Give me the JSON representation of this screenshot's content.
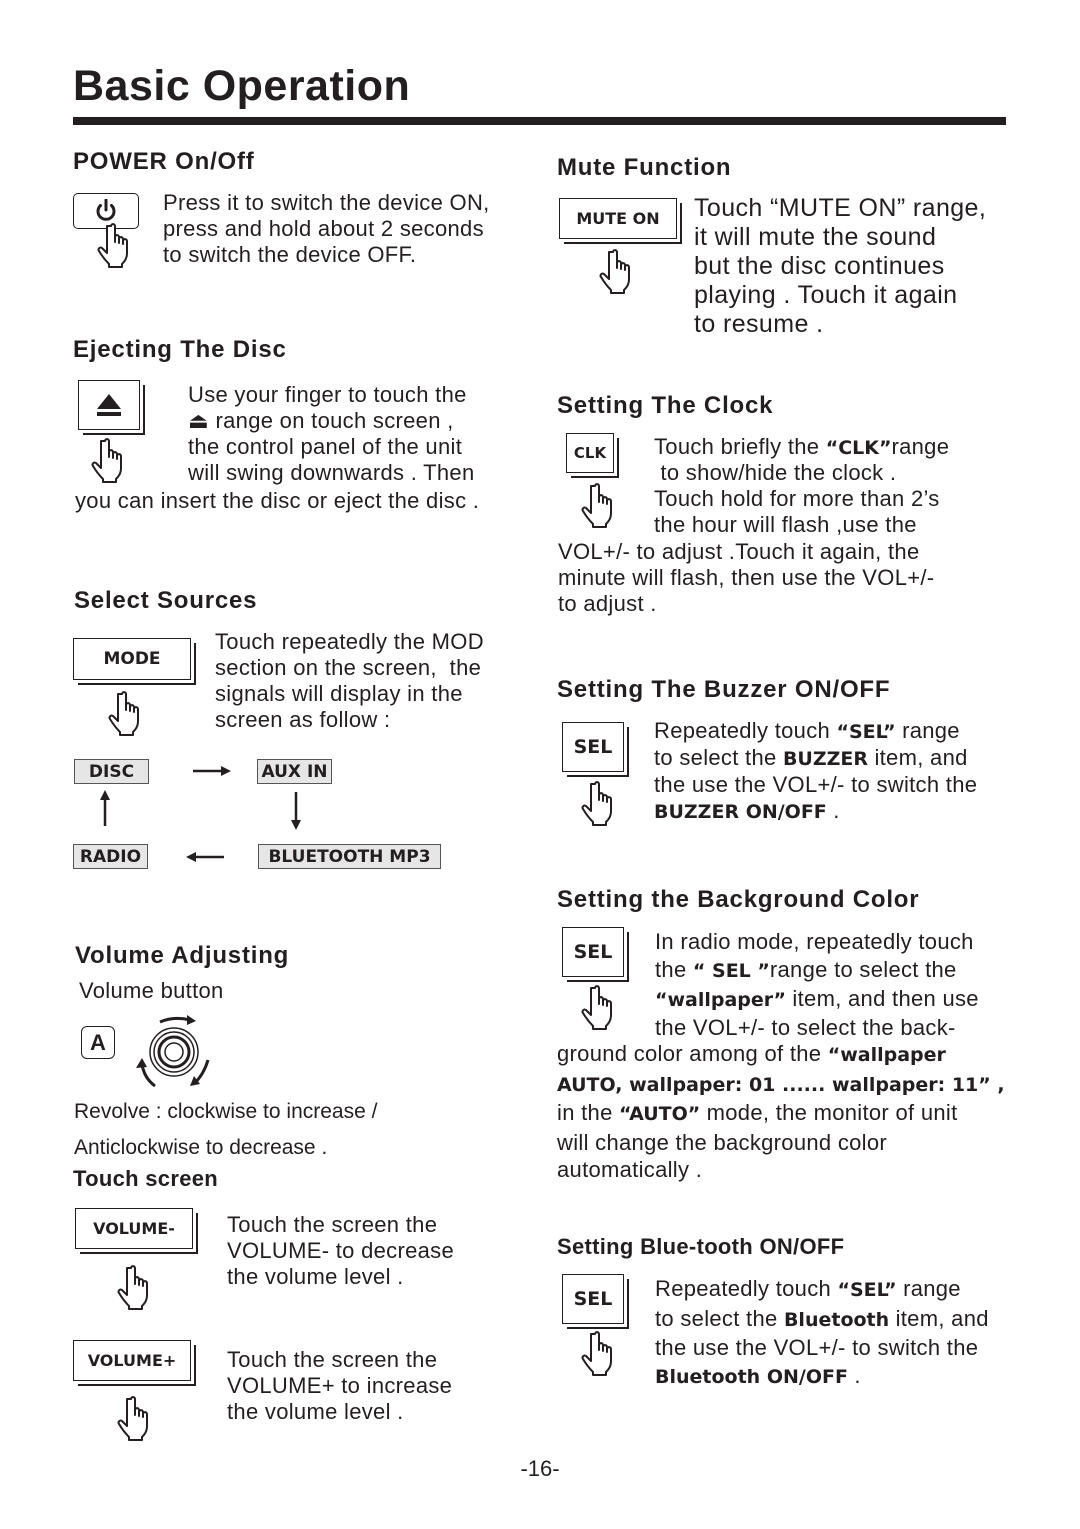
{
  "page": {
    "title": "Basic Operation",
    "page_number": "-16-"
  },
  "power": {
    "heading": "POWER On/Off",
    "button_icon": "power-icon",
    "text": "Press it to switch the device ON,\npress and hold about 2 seconds\nto switch the device OFF."
  },
  "eject": {
    "heading": "Ejecting The Disc",
    "button_icon": "eject-icon",
    "text_indented": "Use your finger to touch the\n⏏ range on touch screen ,\nthe control panel of the unit\nwill swing downwards . Then",
    "text_full": "you can insert the disc or eject the disc ."
  },
  "sources": {
    "heading": "Select Sources",
    "button_label": "MODE",
    "text": "Touch repeatedly the MOD\nsection on the screen,  the\nsignals will display in the\nscreen as follow :",
    "cycle": [
      "DISC",
      "AUX IN",
      "BLUETOOTH MP3",
      "RADIO"
    ]
  },
  "volume": {
    "heading": "Volume Adjusting",
    "subheading": "Volume button",
    "knob_label": "A",
    "revolve_line1": "Revolve : clockwise to increase /",
    "revolve_line2": "Anticlockwise to decrease .",
    "touch_heading": "Touch screen",
    "minus_button": "VOLUME-",
    "minus_text": "Touch the screen the\nVOLUME- to decrease\nthe volume level .",
    "plus_button": "VOLUME+",
    "plus_text": "Touch the screen the\nVOLUME+ to increase\nthe volume level ."
  },
  "mute": {
    "heading": "Mute Function",
    "button_label": "MUTE ON",
    "text": "Touch “MUTE ON” range,\nit will mute the sound\nbut the disc continues\nplaying . Touch it again\nto resume ."
  },
  "clock": {
    "heading": "Setting The Clock",
    "button_label": "CLK",
    "line1_pre": "Touch briefly the ",
    "line1_bold": "“CLK”",
    "line1_post": "range",
    "lines_indented": " to show/hide the clock .\nTouch hold for more than 2’s\nthe hour will flash ,use the",
    "lines_full": "VOL+/- to adjust .Touch it again, the\nminute will flash, then use the VOL+/-\nto adjust ."
  },
  "buzzer": {
    "heading": "Setting The Buzzer ON/OFF",
    "button_label": "SEL",
    "l1_pre": "Repeatedly touch ",
    "l1_bold": "“SEL”",
    "l1_post": " range",
    "l2_pre": "to select the ",
    "l2_bold": "BUZZER",
    "l2_post": " item, and",
    "l3": "the use the VOL+/- to switch the",
    "l4_bold": "BUZZER ON/OFF",
    "l4_post": " ."
  },
  "background": {
    "heading": "Setting the Background Color",
    "button_label": "SEL",
    "l1": "In radio mode, repeatedly touch",
    "l2_pre": "the ",
    "l2_bold": "“ SEL ”",
    "l2_post": "range to select the",
    "l3_bold": "“wallpaper”",
    "l3_post": " item, and then use",
    "l4": "the VOL+/- to select the back-",
    "l5_pre": "ground color among of the ",
    "l5_bold": "“wallpaper",
    "l6_bold": "AUTO, wallpaper: 01 ...... wallpaper: 11” ,",
    "l7_pre": "in the ",
    "l7_bold": "“AUTO”",
    "l7_post": " mode, the monitor of unit",
    "l8": "will change the background color",
    "l9": "automatically ."
  },
  "bluetooth": {
    "heading": "Setting Blue-tooth ON/OFF",
    "button_label": "SEL",
    "l1_pre": "Repeatedly touch ",
    "l1_bold": "“SEL”",
    "l1_post": " range",
    "l2_pre": "to select the ",
    "l2_bold": "Bluetooth",
    "l2_post": " item, and",
    "l3": "the use the VOL+/- to switch the",
    "l4_bold": "Bluetooth ON/OFF",
    "l4_post": " ."
  }
}
